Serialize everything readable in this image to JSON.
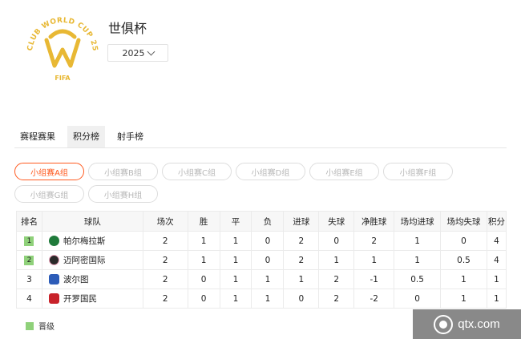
{
  "header": {
    "logo_text_top": "CLUB WORLD CUP 25",
    "logo_text_bottom": "FIFA",
    "title": "世俱杯",
    "year": "2025",
    "logo_color": "#e8b834"
  },
  "tabs": [
    {
      "label": "赛程赛果",
      "active": false
    },
    {
      "label": "积分榜",
      "active": true
    },
    {
      "label": "射手榜",
      "active": false
    }
  ],
  "groups": [
    [
      "小组赛A组",
      "小组赛B组",
      "小组赛C组",
      "小组赛D组",
      "小组赛E组",
      "小组赛F组"
    ],
    [
      "小组赛G组",
      "小组赛H组"
    ]
  ],
  "active_group": "小组赛A组",
  "accent_color": "#ff5a1f",
  "qualified_color": "#8fd17a",
  "table": {
    "headers": [
      "排名",
      "球队",
      "场次",
      "胜",
      "平",
      "负",
      "进球",
      "失球",
      "净胜球",
      "场均进球",
      "场均失球",
      "积分"
    ],
    "rows": [
      {
        "rank": "1",
        "qualified": true,
        "team": "帕尔梅拉斯",
        "crest": "palmeiras-crest",
        "crest_color": "#1f7a3a",
        "played": "2",
        "w": "1",
        "d": "1",
        "l": "0",
        "gf": "2",
        "ga": "0",
        "gd": "2",
        "avg_gf": "1",
        "avg_ga": "0",
        "pts": "4"
      },
      {
        "rank": "2",
        "qualified": true,
        "team": "迈阿密国际",
        "crest": "inter-miami-crest",
        "crest_color": "#2a2a2a",
        "played": "2",
        "w": "1",
        "d": "1",
        "l": "0",
        "gf": "2",
        "ga": "1",
        "gd": "1",
        "avg_gf": "1",
        "avg_ga": "0.5",
        "pts": "4"
      },
      {
        "rank": "3",
        "qualified": false,
        "team": "波尔图",
        "crest": "porto-crest",
        "crest_color": "#2d5cb8",
        "played": "2",
        "w": "0",
        "d": "1",
        "l": "1",
        "gf": "1",
        "ga": "2",
        "gd": "-1",
        "avg_gf": "0.5",
        "avg_ga": "1",
        "pts": "1"
      },
      {
        "rank": "4",
        "qualified": false,
        "team": "开罗国民",
        "crest": "al-ahly-crest",
        "crest_color": "#c8222a",
        "played": "2",
        "w": "0",
        "d": "1",
        "l": "1",
        "gf": "0",
        "ga": "2",
        "gd": "-2",
        "avg_gf": "0",
        "avg_ga": "1",
        "pts": "1"
      }
    ]
  },
  "legend": {
    "label": "晋级"
  },
  "watermark": {
    "text": "qtx.com"
  }
}
